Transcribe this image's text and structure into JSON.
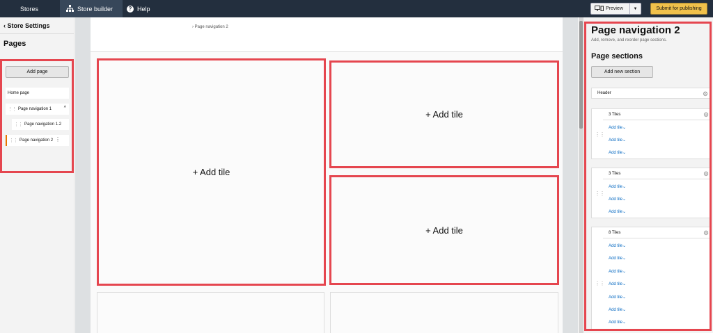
{
  "topbar": {
    "stores_label": "Stores",
    "store_builder_label": "Store builder",
    "help_label": "Help",
    "preview_label": "Preview",
    "submit_label": "Submit for publishing"
  },
  "left_panel": {
    "back_label": "Store Settings",
    "pages_heading": "Pages",
    "add_page_label": "Add page",
    "pages": [
      {
        "label": "Home page"
      },
      {
        "label": "Page navigation 1"
      },
      {
        "label": "Page navigation 1.2"
      },
      {
        "label": "Page navigation 2"
      }
    ]
  },
  "canvas": {
    "breadcrumb": "Page navigation 2",
    "add_tile_label": "+ Add tile"
  },
  "right_panel": {
    "title": "Page navigation 2",
    "subtitle": "Add, remove, and reorder page sections.",
    "sections_heading": "Page sections",
    "add_section_label": "Add new section",
    "header_label": "Header",
    "add_tile_link": "Add tile",
    "sections": [
      {
        "title": "3 Tiles",
        "links": 3
      },
      {
        "title": "3 Tiles",
        "links": 3
      },
      {
        "title": "8 Tiles",
        "links": 7
      }
    ]
  },
  "colors": {
    "topbar": "#232f3e",
    "active_tab": "#37475a",
    "highlight": "#e5464f",
    "submit": "#f0c14b",
    "link": "#0066c0"
  }
}
